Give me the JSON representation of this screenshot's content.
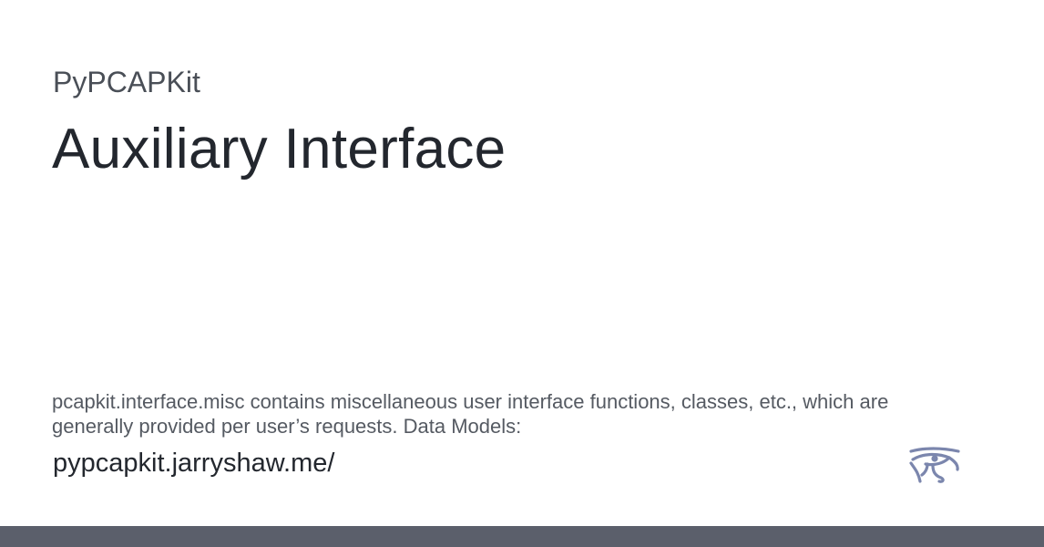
{
  "site": {
    "name": "PyPCAPKit",
    "url": "pypcapkit.jarryshaw.me/"
  },
  "page": {
    "title": "Auxiliary Interface",
    "description": "pcapkit.interface.misc contains miscellaneous user interface functions, classes, etc., which are generally provided per user’s requests. Data Models:"
  },
  "logo": {
    "icon": "eye-of-horus-icon",
    "color": "#7b86ad"
  },
  "theme": {
    "footer_color": "#5b5f6b"
  }
}
